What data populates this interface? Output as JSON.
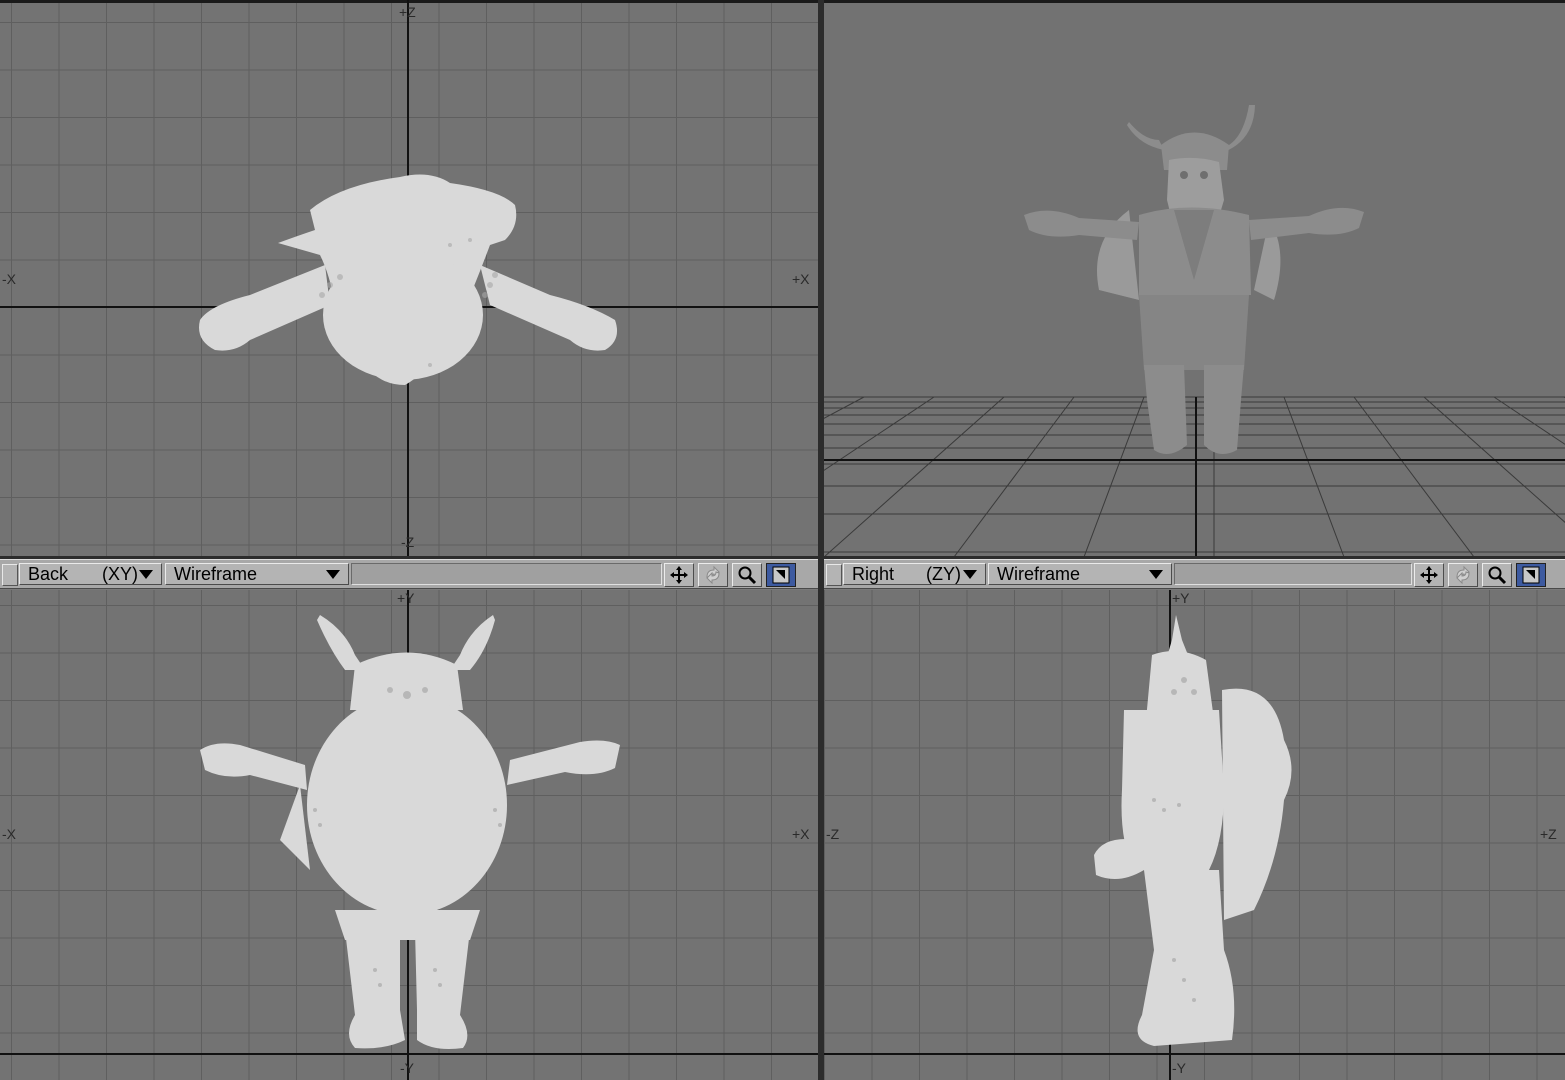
{
  "viewports": {
    "top": {
      "axis_top": "+Z",
      "axis_bottom": "-Z",
      "axis_left": "-X",
      "axis_right": "+X"
    },
    "perspective": {},
    "back": {
      "view_name": "Back",
      "plane": "(XY)",
      "render_mode": "Wireframe",
      "axis_top": "+Y",
      "axis_bottom": "-Y",
      "axis_left": "-X",
      "axis_right": "+X"
    },
    "right": {
      "view_name": "Right",
      "plane": "(ZY)",
      "render_mode": "Wireframe",
      "axis_top": "+Y",
      "axis_bottom": "-Y",
      "axis_left": "-Z",
      "axis_right": "+Z"
    }
  },
  "header_icons": [
    "move-icon",
    "rotate-icon",
    "zoom-icon",
    "maximize-icon"
  ],
  "colors": {
    "viewport_bg": "#737373",
    "grid_line": "#5f5f5f",
    "axis_line": "#111111",
    "mesh": "#d8d8d8",
    "header_bg": "#a8a8a8",
    "active_button": "#3d5aa0"
  }
}
